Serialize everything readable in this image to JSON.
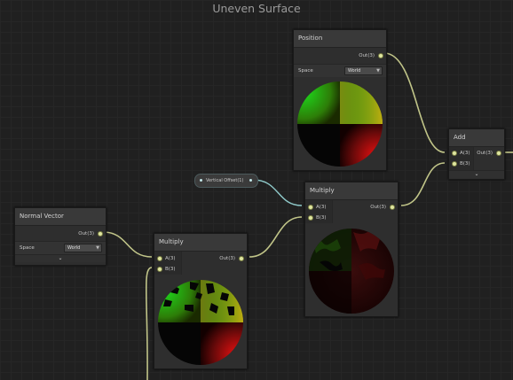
{
  "graph": {
    "title": "Uneven Surface"
  },
  "colors": {
    "wire": "#c0c488",
    "property_wire": "#8fc9c9",
    "port": "#dfe6a0"
  },
  "nodes": {
    "position": {
      "title": "Position",
      "out_label": "Out(3)",
      "space_label": "Space",
      "space_value": "World"
    },
    "add": {
      "title": "Add",
      "in_a": "A(3)",
      "in_b": "B(3)",
      "out_label": "Out(3)",
      "collapse": "⌄"
    },
    "vertical_offset": {
      "label": "Vertical Offset(1)"
    },
    "multiply_top": {
      "title": "Multiply",
      "in_a": "A(3)",
      "in_b": "B(3)",
      "out_label": "Out(3)"
    },
    "normal_vector": {
      "title": "Normal Vector",
      "out_label": "Out(3)",
      "space_label": "Space",
      "space_value": "World",
      "collapse": "⌄"
    },
    "multiply_bottom": {
      "title": "Multiply",
      "in_a": "A(3)",
      "in_b": "B(3)",
      "out_label": "Out(3)"
    }
  }
}
